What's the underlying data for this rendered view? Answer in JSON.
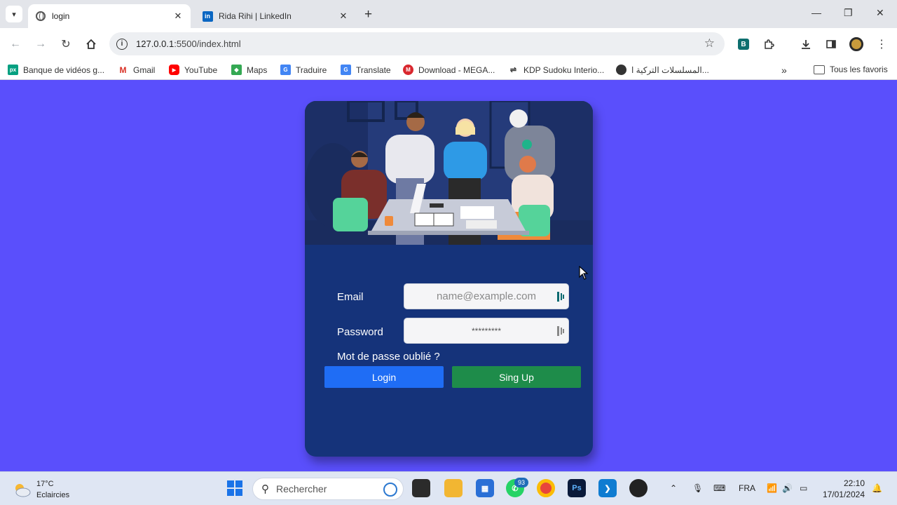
{
  "browser": {
    "tabs": [
      {
        "title": "login",
        "active": true,
        "icon": "globe-icon"
      },
      {
        "title": "Rida Rihi | LinkedIn",
        "active": false,
        "icon": "linkedin-icon"
      }
    ],
    "url_host": "127.0.0.1",
    "url_rest": ":5500/index.html",
    "bookmarks": [
      {
        "label": "Banque de vidéos g...",
        "icon": "pexels-icon",
        "color": "#05a081"
      },
      {
        "label": "Gmail",
        "icon": "gmail-icon",
        "color": "#d93025"
      },
      {
        "label": "YouTube",
        "icon": "youtube-icon",
        "color": "#ff0000"
      },
      {
        "label": "Maps",
        "icon": "maps-icon",
        "color": "#34a853"
      },
      {
        "label": "Traduire",
        "icon": "translate-icon",
        "color": "#4285f4"
      },
      {
        "label": "Translate",
        "icon": "translate-icon",
        "color": "#4285f4"
      },
      {
        "label": "Download - MEGA...",
        "icon": "mega-icon",
        "color": "#d9272e"
      },
      {
        "label": "KDP Sudoku Interio...",
        "icon": "link-icon",
        "color": "#333333"
      },
      {
        "label": "المسلسلات التركية ا...",
        "icon": "globe-icon",
        "color": "#333333"
      }
    ],
    "all_bookmarks": "Tous les favoris"
  },
  "login": {
    "email_label": "Email",
    "email_placeholder": "name@example.com",
    "password_label": "Password",
    "password_value": "*********",
    "forgot": "Mot de passe oublié ?",
    "login_button": "Login",
    "signup_button": "Sing Up",
    "colors": {
      "page_bg": "#5a4ffc",
      "card_bg": "#15337a",
      "login": "#1f6df5",
      "signup": "#1e8c4a"
    }
  },
  "taskbar": {
    "temperature": "17°C",
    "weather": "Eclaircies",
    "search": "Rechercher",
    "whatsapp_badge": "93",
    "lang": "FRA",
    "time": "22:10",
    "date": "17/01/2024"
  }
}
